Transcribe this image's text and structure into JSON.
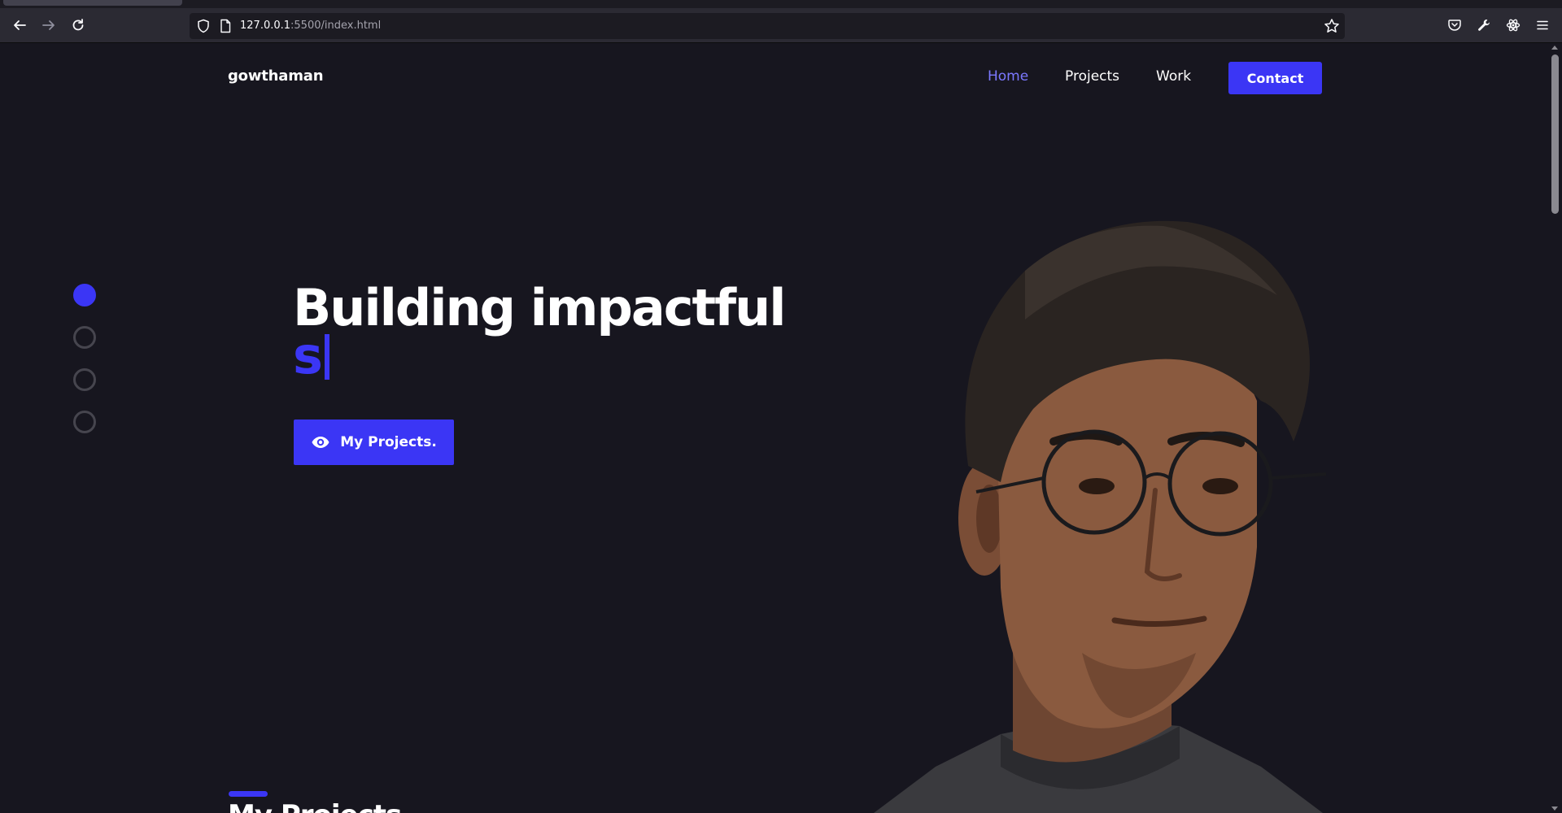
{
  "browser": {
    "url_host": "127.0.0.1",
    "url_path": ":5500/index.html"
  },
  "nav": {
    "logo": "gowthaman",
    "links": [
      "Home",
      "Projects",
      "Work"
    ],
    "contact_label": "Contact",
    "active_link": "Home"
  },
  "hero": {
    "title": "Building impactful",
    "typed_text": "s",
    "button_label": "My Projects.",
    "button_icon": "eye-icon"
  },
  "side_dots": {
    "count": 4,
    "active_index": 0
  },
  "section": {
    "title": "My Projects"
  },
  "colors": {
    "accent": "#3b36f5",
    "background": "#17161f",
    "active_link": "#7b78ff",
    "text": "#ffffff"
  }
}
